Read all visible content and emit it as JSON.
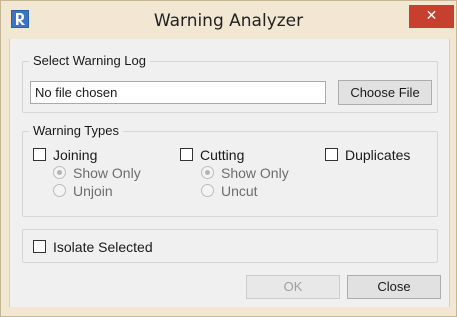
{
  "window": {
    "title": "Warning Analyzer",
    "close_glyph": "✕",
    "app_icon": "revit-icon"
  },
  "select_log": {
    "group_label": "Select Warning Log",
    "file_value": "No file chosen",
    "choose_button": "Choose File"
  },
  "warning_types": {
    "group_label": "Warning Types",
    "joining": {
      "label": "Joining",
      "checked": false,
      "options": [
        {
          "label": "Show Only",
          "selected": true
        },
        {
          "label": "Unjoin",
          "selected": false
        }
      ]
    },
    "cutting": {
      "label": "Cutting",
      "checked": false,
      "options": [
        {
          "label": "Show Only",
          "selected": true
        },
        {
          "label": "Uncut",
          "selected": false
        }
      ]
    },
    "duplicates": {
      "label": "Duplicates",
      "checked": false
    }
  },
  "isolate": {
    "label": "Isolate Selected",
    "checked": false
  },
  "footer": {
    "ok_label": "OK",
    "close_label": "Close"
  },
  "colors": {
    "frame": "#f2e7d3",
    "close_button": "#c7402f",
    "client_bg": "#f0f0f0"
  }
}
